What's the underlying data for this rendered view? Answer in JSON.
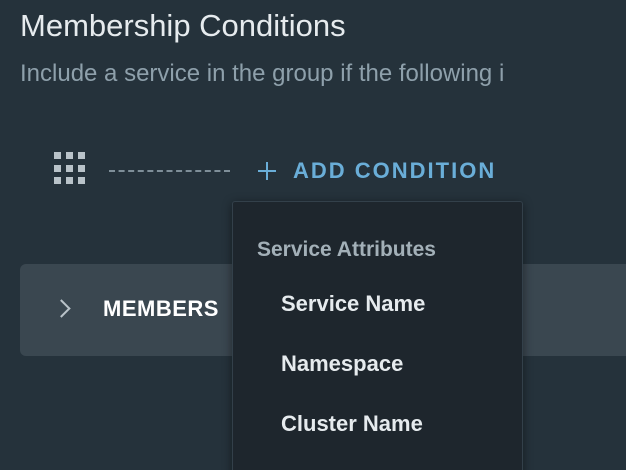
{
  "section": {
    "title": "Membership Conditions",
    "subtitle": "Include a service in the group if the following i"
  },
  "toolbar": {
    "add_condition_label": "ADD CONDITION"
  },
  "members_panel": {
    "label": "MEMBERS"
  },
  "dropdown": {
    "header": "Service Attributes",
    "items": [
      {
        "label": "Service Name"
      },
      {
        "label": "Namespace"
      },
      {
        "label": "Cluster Name"
      }
    ]
  },
  "icons": {
    "drag_handle": "grip-icon",
    "add": "plus-icon",
    "expand": "chevron-right-icon"
  },
  "colors": {
    "background": "#25323b",
    "accent": "#6aaed8",
    "panel": "#3a4750",
    "dropdown_background": "#1e262d"
  }
}
